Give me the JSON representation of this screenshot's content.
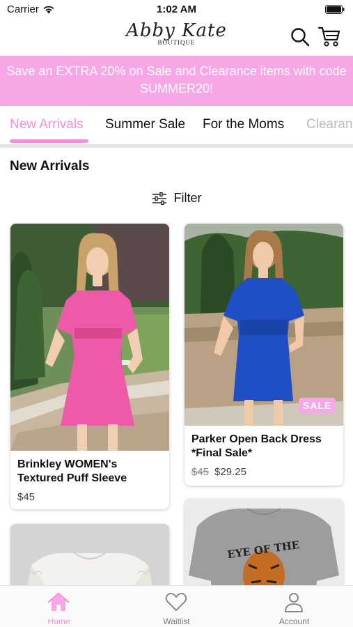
{
  "status_bar": {
    "carrier": "Carrier",
    "time": "1:02 AM"
  },
  "header": {
    "logo_text": "Abby Kate",
    "logo_subtext": "BOUTIQUE",
    "search_icon": "search-icon",
    "cart_icon": "cart-icon"
  },
  "promo": {
    "text": "Save an EXTRA 20% on Sale and Clearance items with code SUMMER20!"
  },
  "tabs": [
    {
      "label": "New Arrivals",
      "active": true
    },
    {
      "label": "Summer Sale",
      "active": false
    },
    {
      "label": "For the Moms",
      "active": false
    },
    {
      "label": "Clearance",
      "active": false
    }
  ],
  "section": {
    "title": "New Arrivals",
    "filter_label": "Filter"
  },
  "products": [
    {
      "name": "Brinkley WOMEN's Textured Puff Sleeve",
      "price": "$45",
      "original_price": "",
      "badge": ""
    },
    {
      "name": "Parker Open Back Dress *Final Sale*",
      "price": "$29.25",
      "original_price": "$45",
      "badge": "SALE"
    },
    {
      "name": "",
      "price": "",
      "original_price": "",
      "badge": ""
    },
    {
      "name": "",
      "price": "",
      "original_price": "",
      "badge": "",
      "shirt_text": "EYE OF THE"
    }
  ],
  "bottom_nav": [
    {
      "label": "Home",
      "icon": "home-icon",
      "active": true
    },
    {
      "label": "Waitlist",
      "icon": "heart-icon",
      "active": false
    },
    {
      "label": "Account",
      "icon": "person-icon",
      "active": false
    }
  ],
  "colors": {
    "accent_pink": "#f58fd9",
    "banner_pink": "#f7a6e6"
  }
}
